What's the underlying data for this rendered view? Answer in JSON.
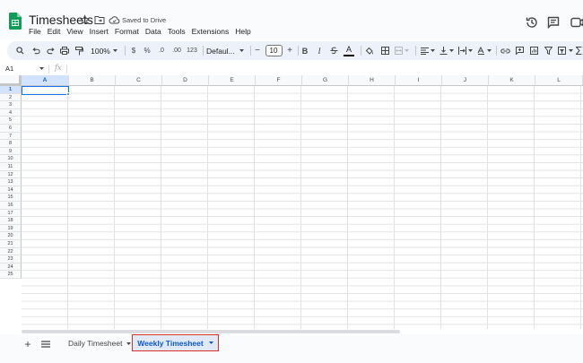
{
  "document": {
    "title": "Timesheets",
    "saved_status": "Saved to Drive"
  },
  "menu": [
    "File",
    "Edit",
    "View",
    "Insert",
    "Format",
    "Data",
    "Tools",
    "Extensions",
    "Help"
  ],
  "toolbar": {
    "zoom": "100%",
    "currency": "$",
    "percent": "%",
    "decrease_decimal": ".0",
    "increase_decimal": ".00",
    "more_formats": "123",
    "font": "Defaul...",
    "font_size": "10",
    "decrease_font": "−",
    "increase_font": "+",
    "bold": "B",
    "italic": "I",
    "text_color": "A"
  },
  "formula_bar": {
    "cell_ref": "A1",
    "fx": "fx"
  },
  "grid": {
    "columns": [
      "A",
      "B",
      "C",
      "D",
      "E",
      "F",
      "G",
      "H",
      "I",
      "J",
      "K",
      "L"
    ],
    "rows": [
      "1",
      "2",
      "3",
      "4",
      "5",
      "6",
      "7",
      "8",
      "9",
      "10",
      "11",
      "12",
      "13",
      "14",
      "15",
      "16",
      "17",
      "18",
      "19",
      "20",
      "21",
      "22",
      "23",
      "24",
      "25"
    ],
    "selected_cell": "A1"
  },
  "sheets": [
    {
      "name": "Daily Timesheet",
      "active": false
    },
    {
      "name": "Weekly Timesheet",
      "active": true
    }
  ],
  "sheetbar": {
    "add_sheet": "+"
  },
  "colors": {
    "accent": "#0b57d0",
    "sheets_green": "#0f9d58",
    "highlight_border": "#d93025"
  }
}
